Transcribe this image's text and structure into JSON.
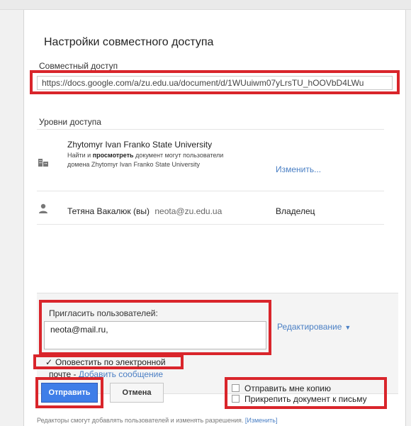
{
  "dialog": {
    "title": "Настройки совместного доступа"
  },
  "link": {
    "label": "Совместный доступ",
    "url": "https://docs.google.com/a/zu.edu.ua/document/d/1WUuiwm07yLrsTU_hOOVbD4LWu"
  },
  "access": {
    "label": "Уровни доступа",
    "organization": {
      "name": "Zhytomyr Ivan Franko State University",
      "desc_part1": "Найти и ",
      "desc_bold": "просмотреть",
      "desc_part2": " документ могут пользователи домена Zhytomyr Ivan Franko State University",
      "change_label": "Изменить..."
    },
    "owner": {
      "name": "Тетяна Вакалюк (вы)",
      "email": "neota@zu.edu.ua",
      "role": "Владелец"
    }
  },
  "invite": {
    "label": "Пригласить пользователей:",
    "value": "neota@mail.ru,",
    "permission": "Редактирование",
    "notify_label": "Оповестить по электронной",
    "notify_checked": true,
    "mail_prefix": "почте - ",
    "add_message": "Добавить сообщение",
    "send_label": "Отправить",
    "cancel_label": "Отмена",
    "send_copy_label": "Отправить мне копию",
    "attach_label": "Прикрепить документ к письму"
  },
  "footer": {
    "text": "Редакторы смогут добавлять пользователей и изменять разрешения. ",
    "change_link": "[Изменить]"
  },
  "colors": {
    "highlight_red": "#d9252b",
    "link_blue": "#4a7fc4",
    "primary_blue": "#3f7ee8"
  }
}
